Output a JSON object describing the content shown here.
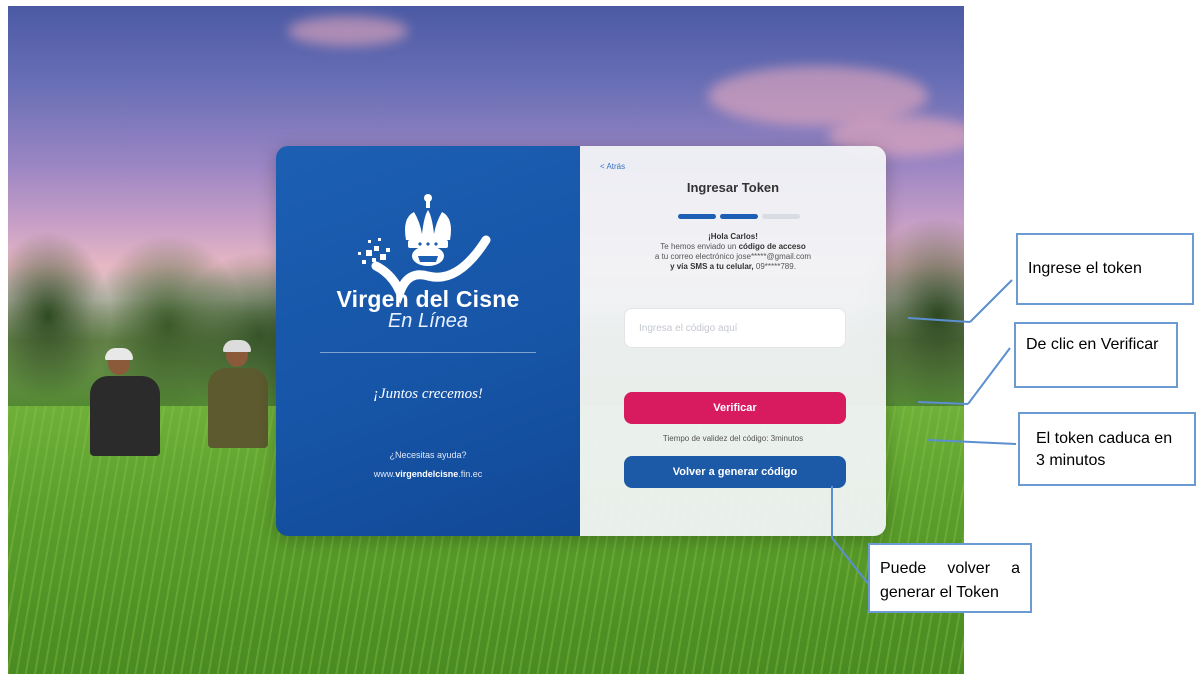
{
  "brand": {
    "name": "Virgen del Cisne",
    "sub": "En Línea",
    "slogan": "¡Juntos crecemos!",
    "help": "¿Necesitas ayuda?",
    "site_prefix": "www.",
    "site_bold": "virgendelcisne",
    "site_suffix": ".fin.ec"
  },
  "form": {
    "back": "< Atrás",
    "title": "Ingresar Token",
    "steps": [
      {
        "active": true
      },
      {
        "active": true
      },
      {
        "active": false
      }
    ],
    "greeting": "¡Hola Carlos!",
    "msg_line1": "Te hemos enviado un",
    "msg_bold1": "código de acceso",
    "msg_line2": "a tu correo electrónico jose*****@gmail.com",
    "msg_bold2": "y vía SMS a tu celular,",
    "msg_line3": "09*****789.",
    "token_placeholder": "Ingresa el código aquí",
    "verify_label": "Verificar",
    "validity": "Tiempo de validez del código: 3minutos",
    "regen_label": "Volver a generar código"
  },
  "notes": {
    "enter_token": "Ingrese el token",
    "click_verify": "De clic en Verificar",
    "expires": "El token caduca en 3 minutos",
    "regenerate": "Puede volver a generar el Token"
  },
  "colors": {
    "brand_blue": "#1c5fb3",
    "verify_pink": "#d81b5f",
    "regen_blue": "#1c5aa8",
    "note_border": "#6c9ad2"
  },
  "icons": {
    "logo": "crown-swan-logo",
    "back": "chevron-left-icon"
  }
}
